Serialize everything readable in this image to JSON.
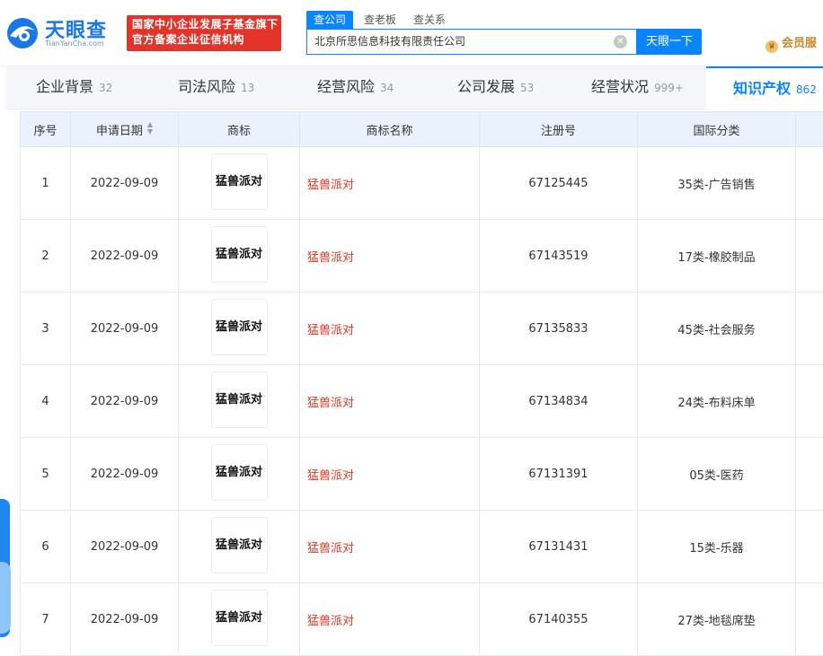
{
  "header": {
    "logo_text": "天眼查",
    "logo_sub": "TianYanCha.com",
    "badge_line1": "国家中小企业发展子基金旗下",
    "badge_line2": "官方备案企业征信机构",
    "search_tabs": [
      "查公司",
      "查老板",
      "查关系"
    ],
    "search_value": "北京所思信息科技有限责任公司",
    "search_button": "天眼一下",
    "vip_label": "会员服"
  },
  "nav": {
    "tabs": [
      {
        "label": "企业背景",
        "count": "32"
      },
      {
        "label": "司法风险",
        "count": "13"
      },
      {
        "label": "经营风险",
        "count": "34"
      },
      {
        "label": "公司发展",
        "count": "53"
      },
      {
        "label": "经营状况",
        "count": "999+"
      },
      {
        "label": "知识产权",
        "count": "862"
      }
    ]
  },
  "table": {
    "headers": [
      "序号",
      "申请日期",
      "商标",
      "商标名称",
      "注册号",
      "国际分类"
    ],
    "rows": [
      {
        "index": "1",
        "date": "2022-09-09",
        "logo_text": "猛兽派对",
        "name": "猛兽派对",
        "reg_no": "67125445",
        "class": "35类-广告销售"
      },
      {
        "index": "2",
        "date": "2022-09-09",
        "logo_text": "猛兽派对",
        "name": "猛兽派对",
        "reg_no": "67143519",
        "class": "17类-橡胶制品"
      },
      {
        "index": "3",
        "date": "2022-09-09",
        "logo_text": "猛兽派对",
        "name": "猛兽派对",
        "reg_no": "67135833",
        "class": "45类-社会服务"
      },
      {
        "index": "4",
        "date": "2022-09-09",
        "logo_text": "猛兽派对",
        "name": "猛兽派对",
        "reg_no": "67134834",
        "class": "24类-布料床单"
      },
      {
        "index": "5",
        "date": "2022-09-09",
        "logo_text": "猛兽派对",
        "name": "猛兽派对",
        "reg_no": "67131391",
        "class": "05类-医药"
      },
      {
        "index": "6",
        "date": "2022-09-09",
        "logo_text": "猛兽派对",
        "name": "猛兽派对",
        "reg_no": "67131431",
        "class": "15类-乐器"
      },
      {
        "index": "7",
        "date": "2022-09-09",
        "logo_text": "猛兽派对",
        "name": "猛兽派对",
        "reg_no": "67140355",
        "class": "27类-地毯席垫"
      }
    ]
  },
  "colors": {
    "brand_blue": "#0a84ff",
    "badge_red": "#e2342a",
    "trademark_name_red": "#e1341f",
    "header_row_bg": "#eaf3fd"
  }
}
